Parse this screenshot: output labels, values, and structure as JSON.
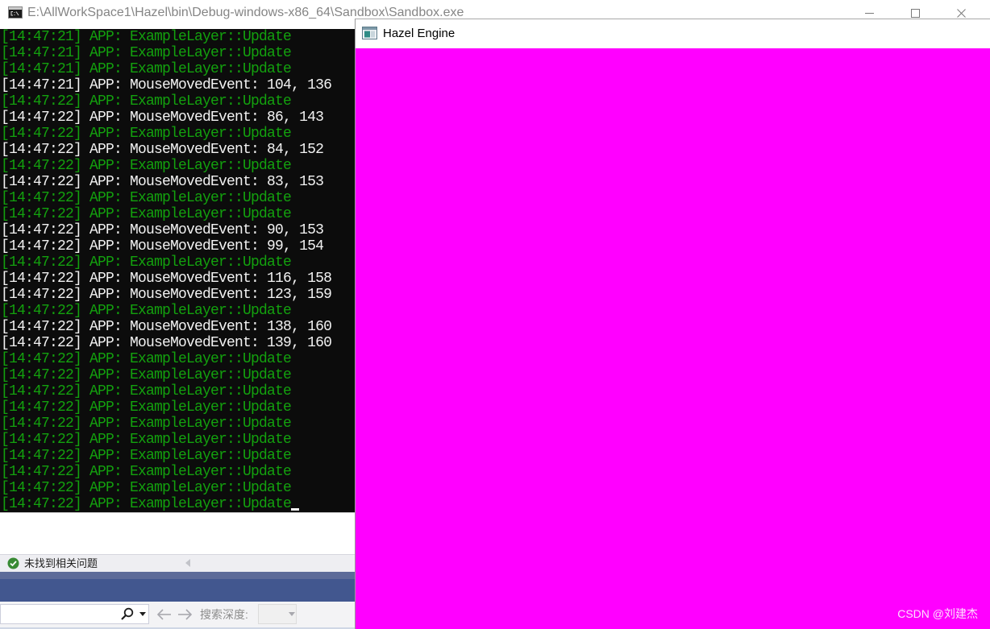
{
  "console_window": {
    "title": "E:\\AllWorkSpace1\\Hazel\\bin\\Debug-windows-x86_64\\Sandbox\\Sandbox.exe",
    "icon": "console-app-icon",
    "controls": [
      "minimize-icon",
      "maximize-icon",
      "close-icon"
    ],
    "background": "#0c0c0c",
    "lines": [
      {
        "text": "[14:47:21] APP: ExampleLayer::Update",
        "color": "#13a10e"
      },
      {
        "text": "[14:47:21] APP: ExampleLayer::Update",
        "color": "#13a10e"
      },
      {
        "text": "[14:47:21] APP: ExampleLayer::Update",
        "color": "#13a10e"
      },
      {
        "text": "[14:47:21] APP: MouseMovedEvent: 104, 136",
        "color": "#f2f2f2"
      },
      {
        "text": "[14:47:22] APP: ExampleLayer::Update",
        "color": "#13a10e"
      },
      {
        "text": "[14:47:22] APP: MouseMovedEvent: 86, 143",
        "color": "#f2f2f2"
      },
      {
        "text": "[14:47:22] APP: ExampleLayer::Update",
        "color": "#13a10e"
      },
      {
        "text": "[14:47:22] APP: MouseMovedEvent: 84, 152",
        "color": "#f2f2f2"
      },
      {
        "text": "[14:47:22] APP: ExampleLayer::Update",
        "color": "#13a10e"
      },
      {
        "text": "[14:47:22] APP: MouseMovedEvent: 83, 153",
        "color": "#f2f2f2"
      },
      {
        "text": "[14:47:22] APP: ExampleLayer::Update",
        "color": "#13a10e"
      },
      {
        "text": "[14:47:22] APP: ExampleLayer::Update",
        "color": "#13a10e"
      },
      {
        "text": "[14:47:22] APP: MouseMovedEvent: 90, 153",
        "color": "#f2f2f2"
      },
      {
        "text": "[14:47:22] APP: MouseMovedEvent: 99, 154",
        "color": "#f2f2f2"
      },
      {
        "text": "[14:47:22] APP: ExampleLayer::Update",
        "color": "#13a10e"
      },
      {
        "text": "[14:47:22] APP: MouseMovedEvent: 116, 158",
        "color": "#f2f2f2"
      },
      {
        "text": "[14:47:22] APP: MouseMovedEvent: 123, 159",
        "color": "#f2f2f2"
      },
      {
        "text": "[14:47:22] APP: ExampleLayer::Update",
        "color": "#13a10e"
      },
      {
        "text": "[14:47:22] APP: MouseMovedEvent: 138, 160",
        "color": "#f2f2f2"
      },
      {
        "text": "[14:47:22] APP: MouseMovedEvent: 139, 160",
        "color": "#f2f2f2"
      },
      {
        "text": "[14:47:22] APP: ExampleLayer::Update",
        "color": "#13a10e"
      },
      {
        "text": "[14:47:22] APP: ExampleLayer::Update",
        "color": "#13a10e"
      },
      {
        "text": "[14:47:22] APP: ExampleLayer::Update",
        "color": "#13a10e"
      },
      {
        "text": "[14:47:22] APP: ExampleLayer::Update",
        "color": "#13a10e"
      },
      {
        "text": "[14:47:22] APP: ExampleLayer::Update",
        "color": "#13a10e"
      },
      {
        "text": "[14:47:22] APP: ExampleLayer::Update",
        "color": "#13a10e"
      },
      {
        "text": "[14:47:22] APP: ExampleLayer::Update",
        "color": "#13a10e"
      },
      {
        "text": "[14:47:22] APP: ExampleLayer::Update",
        "color": "#13a10e"
      },
      {
        "text": "[14:47:22] APP: ExampleLayer::Update",
        "color": "#13a10e"
      },
      {
        "text": "[14:47:22] APP: ExampleLayer::Update",
        "color": "#13a10e"
      }
    ]
  },
  "hazel_window": {
    "title": "Hazel Engine",
    "icon": "app-window-icon",
    "clear_color": "#ff00ff"
  },
  "ide": {
    "status_bar": {
      "icon": "success-check-icon",
      "text": "未找到相关问题"
    },
    "search_toolbar": {
      "search_value": "",
      "search_icon": "search-icon",
      "back_icon": "arrow-left-icon",
      "forward_icon": "arrow-right-icon",
      "depth_label": "搜索深度:",
      "depth_value": ""
    }
  },
  "watermark": {
    "text": "CSDN @刘建杰"
  }
}
